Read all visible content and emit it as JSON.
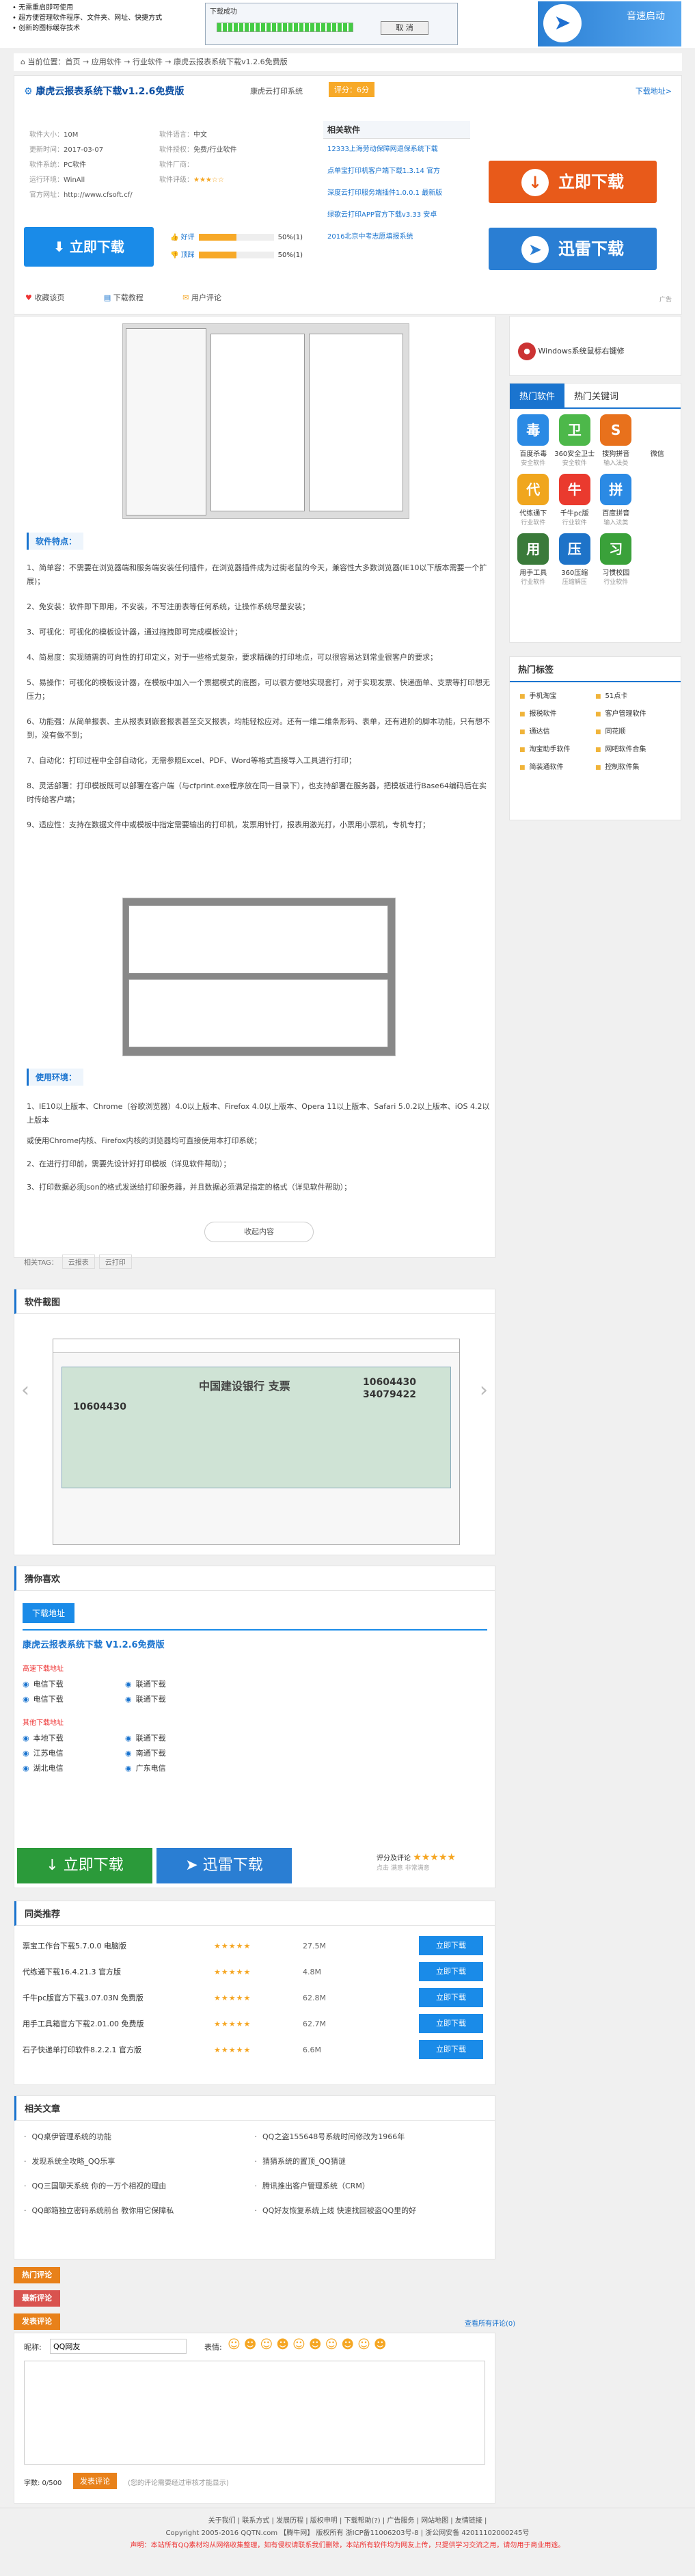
{
  "banner": {
    "lines": [
      "• 无需重启即可使用",
      "• 超方便管理软件程序、文件夹、网址、快捷方式",
      "• 创新的图标缓存技术"
    ],
    "dialog_title": "下载成功",
    "cancel": "取 消",
    "brand": "音速启动"
  },
  "breadcrumb": "当前位置：首页 → 应用软件 → 行业软件 → 康虎云报表系统下载v1.2.6免费版",
  "software": {
    "title": "康虎云报表系统下载v1.2.6免费版",
    "subtitle": "康虎云打印系统",
    "score": "评分：6分",
    "download_addr": "下载地址>",
    "meta": [
      [
        "软件大小：",
        "10M",
        "软件语言：",
        "中文"
      ],
      [
        "更新时间：",
        "2017-03-07",
        "软件授权：",
        "免费/行业软件"
      ],
      [
        "软件系统：",
        "PC软件",
        "软件厂商：",
        ""
      ],
      [
        "运行环境：",
        "WinAll",
        "软件评级：",
        "★★★☆☆"
      ],
      [
        "官方网址：",
        "http://www.cfsoft.cf/",
        "",
        ""
      ]
    ],
    "related_title": "相关软件",
    "related": [
      "12333上海劳动保障网退保系统下载",
      "点单宝打印机客户端下载1.3.14 官方",
      "深度云打印服务端插件1.0.0.1 最新版",
      "绿歌云打印APP官方下载v3.33 安卓",
      "2016北京中考志愿填报系统"
    ],
    "btn_download": "立即下载",
    "btn_xunlei": "迅雷下载",
    "btn_local": "立即下载",
    "vote_good": "好评",
    "vote_bad": "顶踩",
    "good_pct": "50%(1)",
    "bad_pct": "50%(1)",
    "actions": [
      "收藏该页",
      "下载教程",
      "用户评论"
    ],
    "ad": "广告"
  },
  "features": {
    "heading": "软件特点：",
    "items": [
      "1、简单容：不需要在浏览器端和服务端安装任何插件，在浏览器插件成为过街老鼠的今天，兼容性大多数浏览器(IE10以下版本需要一个扩展)；",
      "2、免安装：软件即下即用，不安装，不写注册表等任何系统，让操作系统尽量安装；",
      "3、可视化：可视化的模板设计器，通过拖拽即可完成模板设计；",
      "4、简易度：实现随需的可向性的打印定义，对于一些格式复杂，要求精确的打印地点，可以很容易达到常业很客户的要求；",
      "5、易操作：可视化的模板设计器，在模板中加入一个票据模式的底图，可以很方便地实现套打，对于实现发票、快递面单、支票等打印想无压力；",
      "6、功能强：从简单报表、主从报表到嵌套报表甚至交叉报表，均能轻松应对。还有一维二维条形码、表单，还有进阶的脚本功能，只有想不到，没有做不到；",
      "7、自动化：打印过程中全部自动化，无需参照Excel、PDF、Word等格式直接导入工具进行打印；",
      "8、灵活部署：打印模板既可以部署在客户端（与cfprint.exe程序放在同一目录下），也支持部署在服务器，把模板进行Base64编码后在实时传给客户端；",
      "9、适应性：支持在数据文件中或模板中指定需要输出的打印机，发票用针打，报表用激光打，小票用小票机，专机专打；"
    ]
  },
  "env": {
    "heading": "使用环境：",
    "items": [
      "1、IE10以上版本、Chrome（谷歌浏览器）4.0以上版本、Firefox 4.0以上版本、Opera 11以上版本、Safari 5.0.2以上版本、iOS 4.2以上版本",
      "或使用Chrome内核、Firefox内核的浏览器均可直接使用本打印系统；",
      "2、在进行打印前，需要先设计好打印模板（详见软件帮助）；",
      "3、打印数据必须Json的格式发送给打印服务器，并且数据必须满足指定的格式（详见软件帮助）；"
    ],
    "collapse": "收起内容"
  },
  "tags_label": "相关TAG：",
  "tags": [
    "云报表",
    "云打印"
  ],
  "screenshot": {
    "heading": "软件截图",
    "bank": "中国建设银行 支票",
    "num1": "10604430",
    "num2": "34079422"
  },
  "guess": {
    "heading": "猜你喜欢"
  },
  "dl": {
    "tab": "下载地址",
    "title": "康虎云报表系统下载 V1.2.6免费版",
    "sec1": "高速下载地址",
    "sec1_links": [
      "电信下载",
      "联通下载",
      "电信下载",
      "联通下载"
    ],
    "sec2": "其他下载地址",
    "sec2_links": [
      "本地下载",
      "联通下载",
      "江苏电信",
      "南通下载",
      "湖北电信",
      "广东电信"
    ],
    "btn1": "立即下载",
    "btn2": "迅雷下载",
    "rating_label": "评分及评论",
    "rating_stars": "★★★★★",
    "rating_sub": "点击 满意 非常满意"
  },
  "recommend": {
    "heading": "同类推荐",
    "btn": "立即下载",
    "items": [
      {
        "name": "票宝工作台下载5.7.0.0 电脑版",
        "stars": "★★★★★",
        "size": "27.5M"
      },
      {
        "name": "代练通下载16.4.21.3 官方版",
        "stars": "★★★★★",
        "size": "4.8M"
      },
      {
        "name": "千牛pc版官方下载3.07.03N 免费版",
        "stars": "★★★★★",
        "size": "62.8M"
      },
      {
        "name": "用手工具箱官方下载2.01.00 免费版",
        "stars": "★★★★★",
        "size": "62.7M"
      },
      {
        "name": "石子快递单打印软件8.2.2.1 官方版",
        "stars": "★★★★★",
        "size": "6.6M"
      }
    ]
  },
  "articles": {
    "heading": "相关文章",
    "items": [
      "QQ桌伊管理系统的功能",
      "QQ之盗155648号系统时间修改为1966年",
      "发现系统全攻略_QQ乐享",
      "猜猜系统的置顶_QQ猜谜",
      "QQ三国聊天系统 你的一万个相视的理由",
      "腾讯推出客户管理系统（CRM）",
      "QQ邮箱独立密码系统前台 教你用它保障私",
      "QQ好友恢复系统上线 快速找回被盗QQ里的好"
    ]
  },
  "comments": {
    "tab1": "热门评论",
    "tab2": "最新评论",
    "tab3": "发表评论",
    "view_all": "查看所有评论(0)",
    "nick_label": "昵称:",
    "nick_value": "QQ网友",
    "face_label": "表情:",
    "count_label": "字数: 0/500",
    "submit": "发表评论",
    "note": "(您的评论需要经过审核才能显示)"
  },
  "side": {
    "win_item": "Windows系统鼠标右键修",
    "hot_tab": "热门软件",
    "hot_tab2": "热门关键词",
    "apps": [
      {
        "n": "百度杀毒",
        "c": "安全软件",
        "col": "#2b8ae4",
        "g": "毒"
      },
      {
        "n": "360安全卫士",
        "c": "安全软件",
        "col": "#4db84a",
        "g": "卫"
      },
      {
        "n": "搜狗拼音",
        "c": "输入法类",
        "col": "#e8711c",
        "g": "S"
      },
      {
        "n": "微信",
        "c": "",
        "col": "#ffffff",
        "g": ""
      },
      {
        "n": "代练通下",
        "c": "行业软件",
        "col": "#f0a61e",
        "g": "代"
      },
      {
        "n": "千牛pc版",
        "c": "行业软件",
        "col": "#ea3a2e",
        "g": "牛"
      },
      {
        "n": "百度拼音",
        "c": "输入法类",
        "col": "#2b8ae4",
        "g": "拼"
      },
      {
        "n": "",
        "c": "",
        "col": "#ffffff",
        "g": ""
      },
      {
        "n": "用手工具",
        "c": "行业软件",
        "col": "#3a7a3a",
        "g": "用"
      },
      {
        "n": "360压缩",
        "c": "压缩解压",
        "col": "#1e73c8",
        "g": "压"
      },
      {
        "n": "习惯校园",
        "c": "行业软件",
        "col": "#3aa13a",
        "g": "习"
      },
      {
        "n": "",
        "c": "",
        "col": "#ffffff",
        "g": ""
      }
    ],
    "tags_heading": "热门标签",
    "tags": [
      "手机淘宝",
      "51点卡",
      "报税软件",
      "客户管理软件",
      "通达信",
      "同花顺",
      "淘宝助手软件",
      "网吧软件合集",
      "简装通软件",
      "控制软件集"
    ]
  },
  "footer": {
    "links": "关于我们 | 联系方式 | 发展历程 | 版权申明 | 下载帮助(?) | 广告服务 | 网站地图 | 友情链接 | ",
    "copyright": "Copyright 2005-2016 QQTN.com 【腾牛网】 版权所有 浙ICP备11006203号-8 | 浙公网安备 42011102000245号",
    "notice": "声明：本站所有QQ素材均从网络收集整理，如有侵权请联系我们删除，本站所有软件均为网友上传，只提供学习交流之用，请勿用于商业用途。"
  }
}
